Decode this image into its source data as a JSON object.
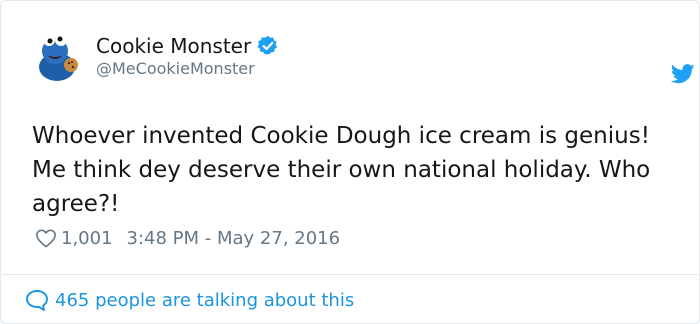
{
  "tweet": {
    "display_name": "Cookie Monster",
    "handle": "@MeCookieMonster",
    "verified": true,
    "text": "Whoever invented Cookie Dough ice cream is genius! Me think dey deserve their own national holiday. Who agree?!",
    "likes": "1,001",
    "timestamp": "3:48 PM - May 27, 2016",
    "talking": "465 people are talking about this"
  },
  "icons": {
    "avatar": "cookie-monster-avatar",
    "verified": "verified-badge-icon",
    "logo": "twitter-bird-icon",
    "like": "heart-icon",
    "reply": "speech-bubble-icon"
  },
  "colors": {
    "accent": "#1da1f2",
    "link": "#1b95e0",
    "muted": "#657786",
    "text": "#14171a"
  }
}
